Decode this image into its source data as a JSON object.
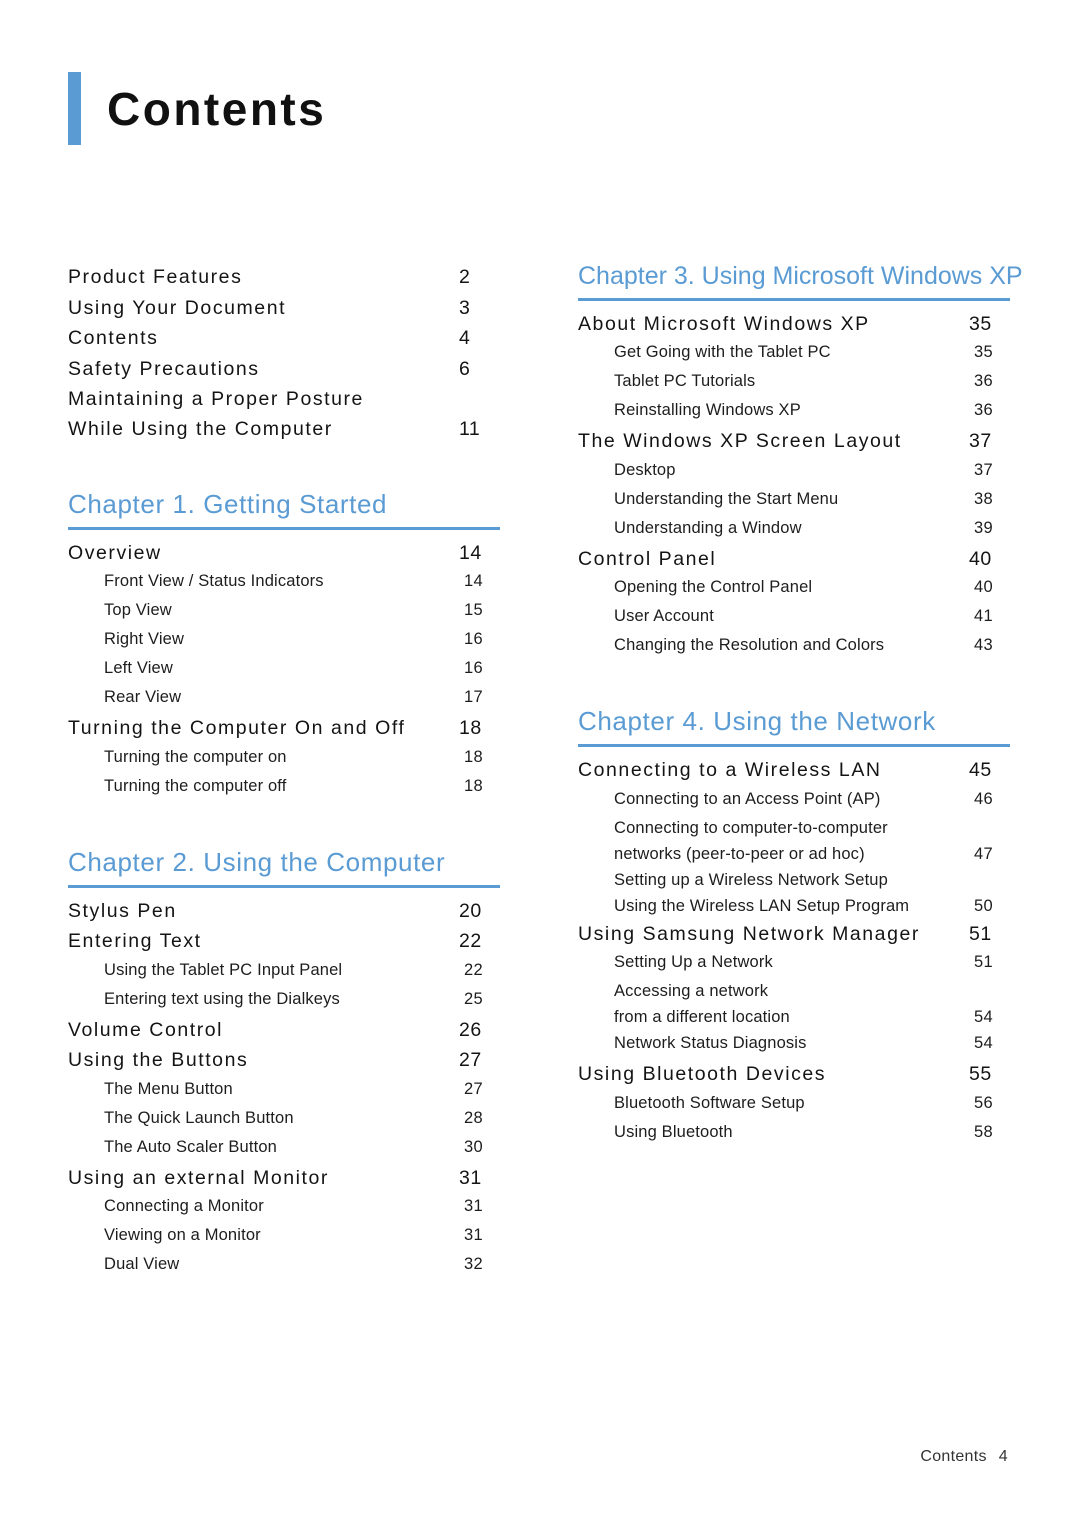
{
  "page": {
    "title": "Contents",
    "accent_color": "#5a9bd3",
    "footer_label": "Contents",
    "footer_page": "4"
  },
  "left_column": {
    "frontmatter": [
      {
        "text": "Product Features",
        "page": "2"
      },
      {
        "text": "Using Your Document",
        "page": "3"
      },
      {
        "text": "Contents",
        "page": "4"
      },
      {
        "text": "Safety Precautions",
        "page": "6"
      },
      {
        "text": "Maintaining a Proper Posture\nWhile Using the Computer",
        "page": "11",
        "page_on_second_line": true
      }
    ],
    "chapters": [
      {
        "heading": "Chapter 1. Getting Started",
        "entries": [
          {
            "level": 1,
            "text": "Overview",
            "page": "14"
          },
          {
            "level": 2,
            "text": "Front View / Status Indicators",
            "page": "14"
          },
          {
            "level": 2,
            "text": "Top View",
            "page": "15"
          },
          {
            "level": 2,
            "text": "Right View",
            "page": "16"
          },
          {
            "level": 2,
            "text": "Left View",
            "page": "16"
          },
          {
            "level": 2,
            "text": "Rear View",
            "page": "17"
          },
          {
            "level": 1,
            "text": "Turning the Computer On and Off",
            "page": "18"
          },
          {
            "level": 2,
            "text": "Turning the computer on",
            "page": "18"
          },
          {
            "level": 2,
            "text": "Turning the computer off",
            "page": "18"
          }
        ]
      },
      {
        "heading": "Chapter 2. Using the Computer",
        "entries": [
          {
            "level": 1,
            "text": "Stylus Pen",
            "page": "20"
          },
          {
            "level": 1,
            "text": "Entering Text",
            "page": "22"
          },
          {
            "level": 2,
            "text": "Using the Tablet PC Input Panel",
            "page": "22"
          },
          {
            "level": 2,
            "text": "Entering text using the Dialkeys",
            "page": "25"
          },
          {
            "level": 1,
            "text": "Volume Control",
            "page": "26"
          },
          {
            "level": 1,
            "text": "Using the Buttons",
            "page": "27"
          },
          {
            "level": 2,
            "text": "The Menu Button",
            "page": "27"
          },
          {
            "level": 2,
            "text": "The Quick Launch Button",
            "page": "28"
          },
          {
            "level": 2,
            "text": "The Auto Scaler Button",
            "page": "30"
          },
          {
            "level": 1,
            "text": "Using an external Monitor",
            "page": "31"
          },
          {
            "level": 2,
            "text": "Connecting a Monitor",
            "page": "31"
          },
          {
            "level": 2,
            "text": "Viewing on a Monitor",
            "page": "31"
          },
          {
            "level": 2,
            "text": "Dual View",
            "page": "32"
          }
        ]
      }
    ]
  },
  "right_column": {
    "chapters": [
      {
        "heading": "Chapter 3. Using Microsoft Windows XP",
        "heading_tight": true,
        "entries": [
          {
            "level": 1,
            "text": "About Microsoft Windows XP",
            "page": "35"
          },
          {
            "level": 2,
            "text": "Get Going with the Tablet PC",
            "page": "35"
          },
          {
            "level": 2,
            "text": "Tablet PC Tutorials",
            "page": "36"
          },
          {
            "level": 2,
            "text": "Reinstalling Windows XP",
            "page": "36"
          },
          {
            "level": 1,
            "text": "The Windows XP Screen Layout",
            "page": "37"
          },
          {
            "level": 2,
            "text": "Desktop",
            "page": "37"
          },
          {
            "level": 2,
            "text": "Understanding the Start Menu",
            "page": "38"
          },
          {
            "level": 2,
            "text": "Understanding a Window",
            "page": "39"
          },
          {
            "level": 1,
            "text": "Control Panel",
            "page": "40"
          },
          {
            "level": 2,
            "text": "Opening the Control Panel",
            "page": "40"
          },
          {
            "level": 2,
            "text": "User Account",
            "page": "41"
          },
          {
            "level": 2,
            "text": "Changing the Resolution and Colors",
            "page": "43"
          }
        ]
      },
      {
        "heading": "Chapter 4. Using the Network",
        "entries": [
          {
            "level": 1,
            "text": "Connecting to a Wireless LAN",
            "page": "45"
          },
          {
            "level": 2,
            "text": "Connecting to an Access Point (AP)",
            "page": "46"
          },
          {
            "level": 2,
            "text": "Connecting to computer-to-computer\nnetworks (peer-to-peer or ad hoc)",
            "page": "47",
            "page_on_second_line": true
          },
          {
            "level": 2,
            "text": "Setting up a Wireless Network Setup\nUsing the Wireless LAN Setup Program",
            "page": "50",
            "page_on_second_line": true
          },
          {
            "level": 1,
            "text": "Using Samsung Network Manager",
            "page": "51"
          },
          {
            "level": 2,
            "text": "Setting Up a Network",
            "page": "51"
          },
          {
            "level": 2,
            "text": "Accessing a network\nfrom a different location",
            "page": "54",
            "page_on_second_line": true
          },
          {
            "level": 2,
            "text": "Network Status Diagnosis",
            "page": "54"
          },
          {
            "level": 1,
            "text": "Using Bluetooth Devices",
            "page": "55"
          },
          {
            "level": 2,
            "text": "Bluetooth Software Setup",
            "page": "56"
          },
          {
            "level": 2,
            "text": "Using Bluetooth",
            "page": "58"
          }
        ]
      }
    ]
  }
}
